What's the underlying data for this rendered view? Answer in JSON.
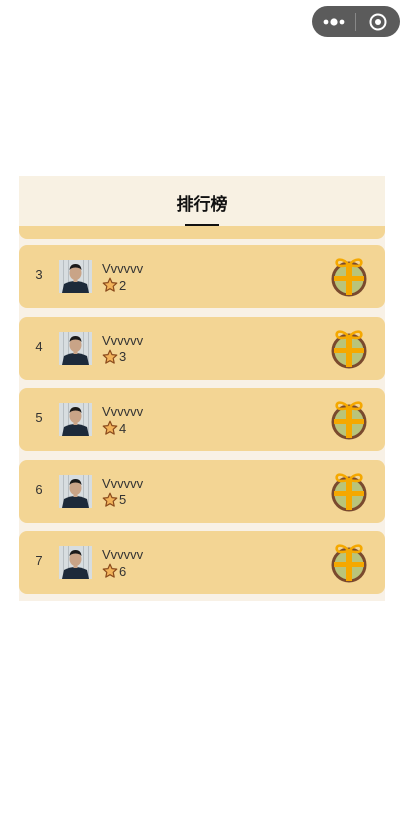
{
  "page": {
    "title": "排行榜"
  },
  "capsule": {
    "more_icon": "more-dots-icon",
    "close_icon": "target-close-icon"
  },
  "rows": [
    {
      "rank": "3",
      "name": "Vvvvvv",
      "score": "2"
    },
    {
      "rank": "4",
      "name": "Vvvvvv",
      "score": "3"
    },
    {
      "rank": "5",
      "name": "Vvvvvv",
      "score": "4"
    },
    {
      "rank": "6",
      "name": "Vvvvvv",
      "score": "5"
    },
    {
      "rank": "7",
      "name": "Vvvvvv",
      "score": "6"
    }
  ],
  "colors": {
    "row_background": "#f3d594",
    "panel_background": "#f8f1e6",
    "gift_ring": "#7a4a2e",
    "gift_fill": "#b9c47a",
    "gift_ribbon": "#f5a800"
  }
}
